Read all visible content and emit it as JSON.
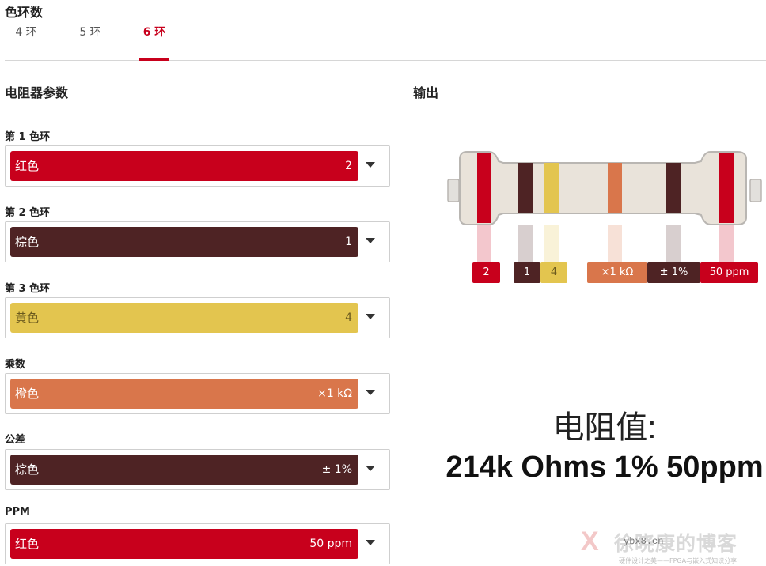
{
  "header": {
    "title": "色环数"
  },
  "tabs": [
    {
      "label": "4 环",
      "active": false
    },
    {
      "label": "5 环",
      "active": false
    },
    {
      "label": "6 环",
      "active": true
    }
  ],
  "params": {
    "title": "电阻器参数",
    "fields": [
      {
        "label": "第 1 色环",
        "color_name": "红色",
        "value": "2",
        "color": "#c8001c",
        "text_color": "#ffffff"
      },
      {
        "label": "第 2 色环",
        "color_name": "棕色",
        "value": "1",
        "color": "#4e2324",
        "text_color": "#ffffff"
      },
      {
        "label": "第 3 色环",
        "color_name": "黄色",
        "value": "4",
        "color": "#e3c54f",
        "text_color": "#6b5a1e"
      },
      {
        "label": "乘数",
        "color_name": "橙色",
        "value": "×1 kΩ",
        "color": "#d9764b",
        "text_color": "#ffffff"
      },
      {
        "label": "公差",
        "color_name": "棕色",
        "value": "± 1%",
        "color": "#4e2324",
        "text_color": "#ffffff"
      },
      {
        "label": "PPM",
        "color_name": "红色",
        "value": "50 ppm",
        "color": "#c8001c",
        "text_color": "#ffffff"
      }
    ]
  },
  "output": {
    "title": "输出",
    "resistor_body_color": "#e9e3da",
    "tags": [
      {
        "text": "2",
        "color": "#c8001c",
        "text_color": "#ffffff"
      },
      {
        "text": "1",
        "color": "#4e2324",
        "text_color": "#ffffff"
      },
      {
        "text": "4",
        "color": "#e3c54f",
        "text_color": "#6b5a1e"
      },
      {
        "text": "×1 kΩ",
        "color": "#d9764b",
        "text_color": "#ffffff"
      },
      {
        "text": "± 1%",
        "color": "#4e2324",
        "text_color": "#ffffff"
      },
      {
        "text": "50 ppm",
        "color": "#c8001c",
        "text_color": "#ffffff"
      }
    ],
    "resistance_label": "电阻值:",
    "resistance_value": "214k Ohms 1% 50ppm"
  },
  "watermark": {
    "mark": "X",
    "name": "徐晓康的博客",
    "url": "ybx8.cn",
    "sub": "硬件设计之美——FPGA与嵌入式知识分享"
  },
  "icons": {
    "dropdown": "caret-down-icon"
  }
}
